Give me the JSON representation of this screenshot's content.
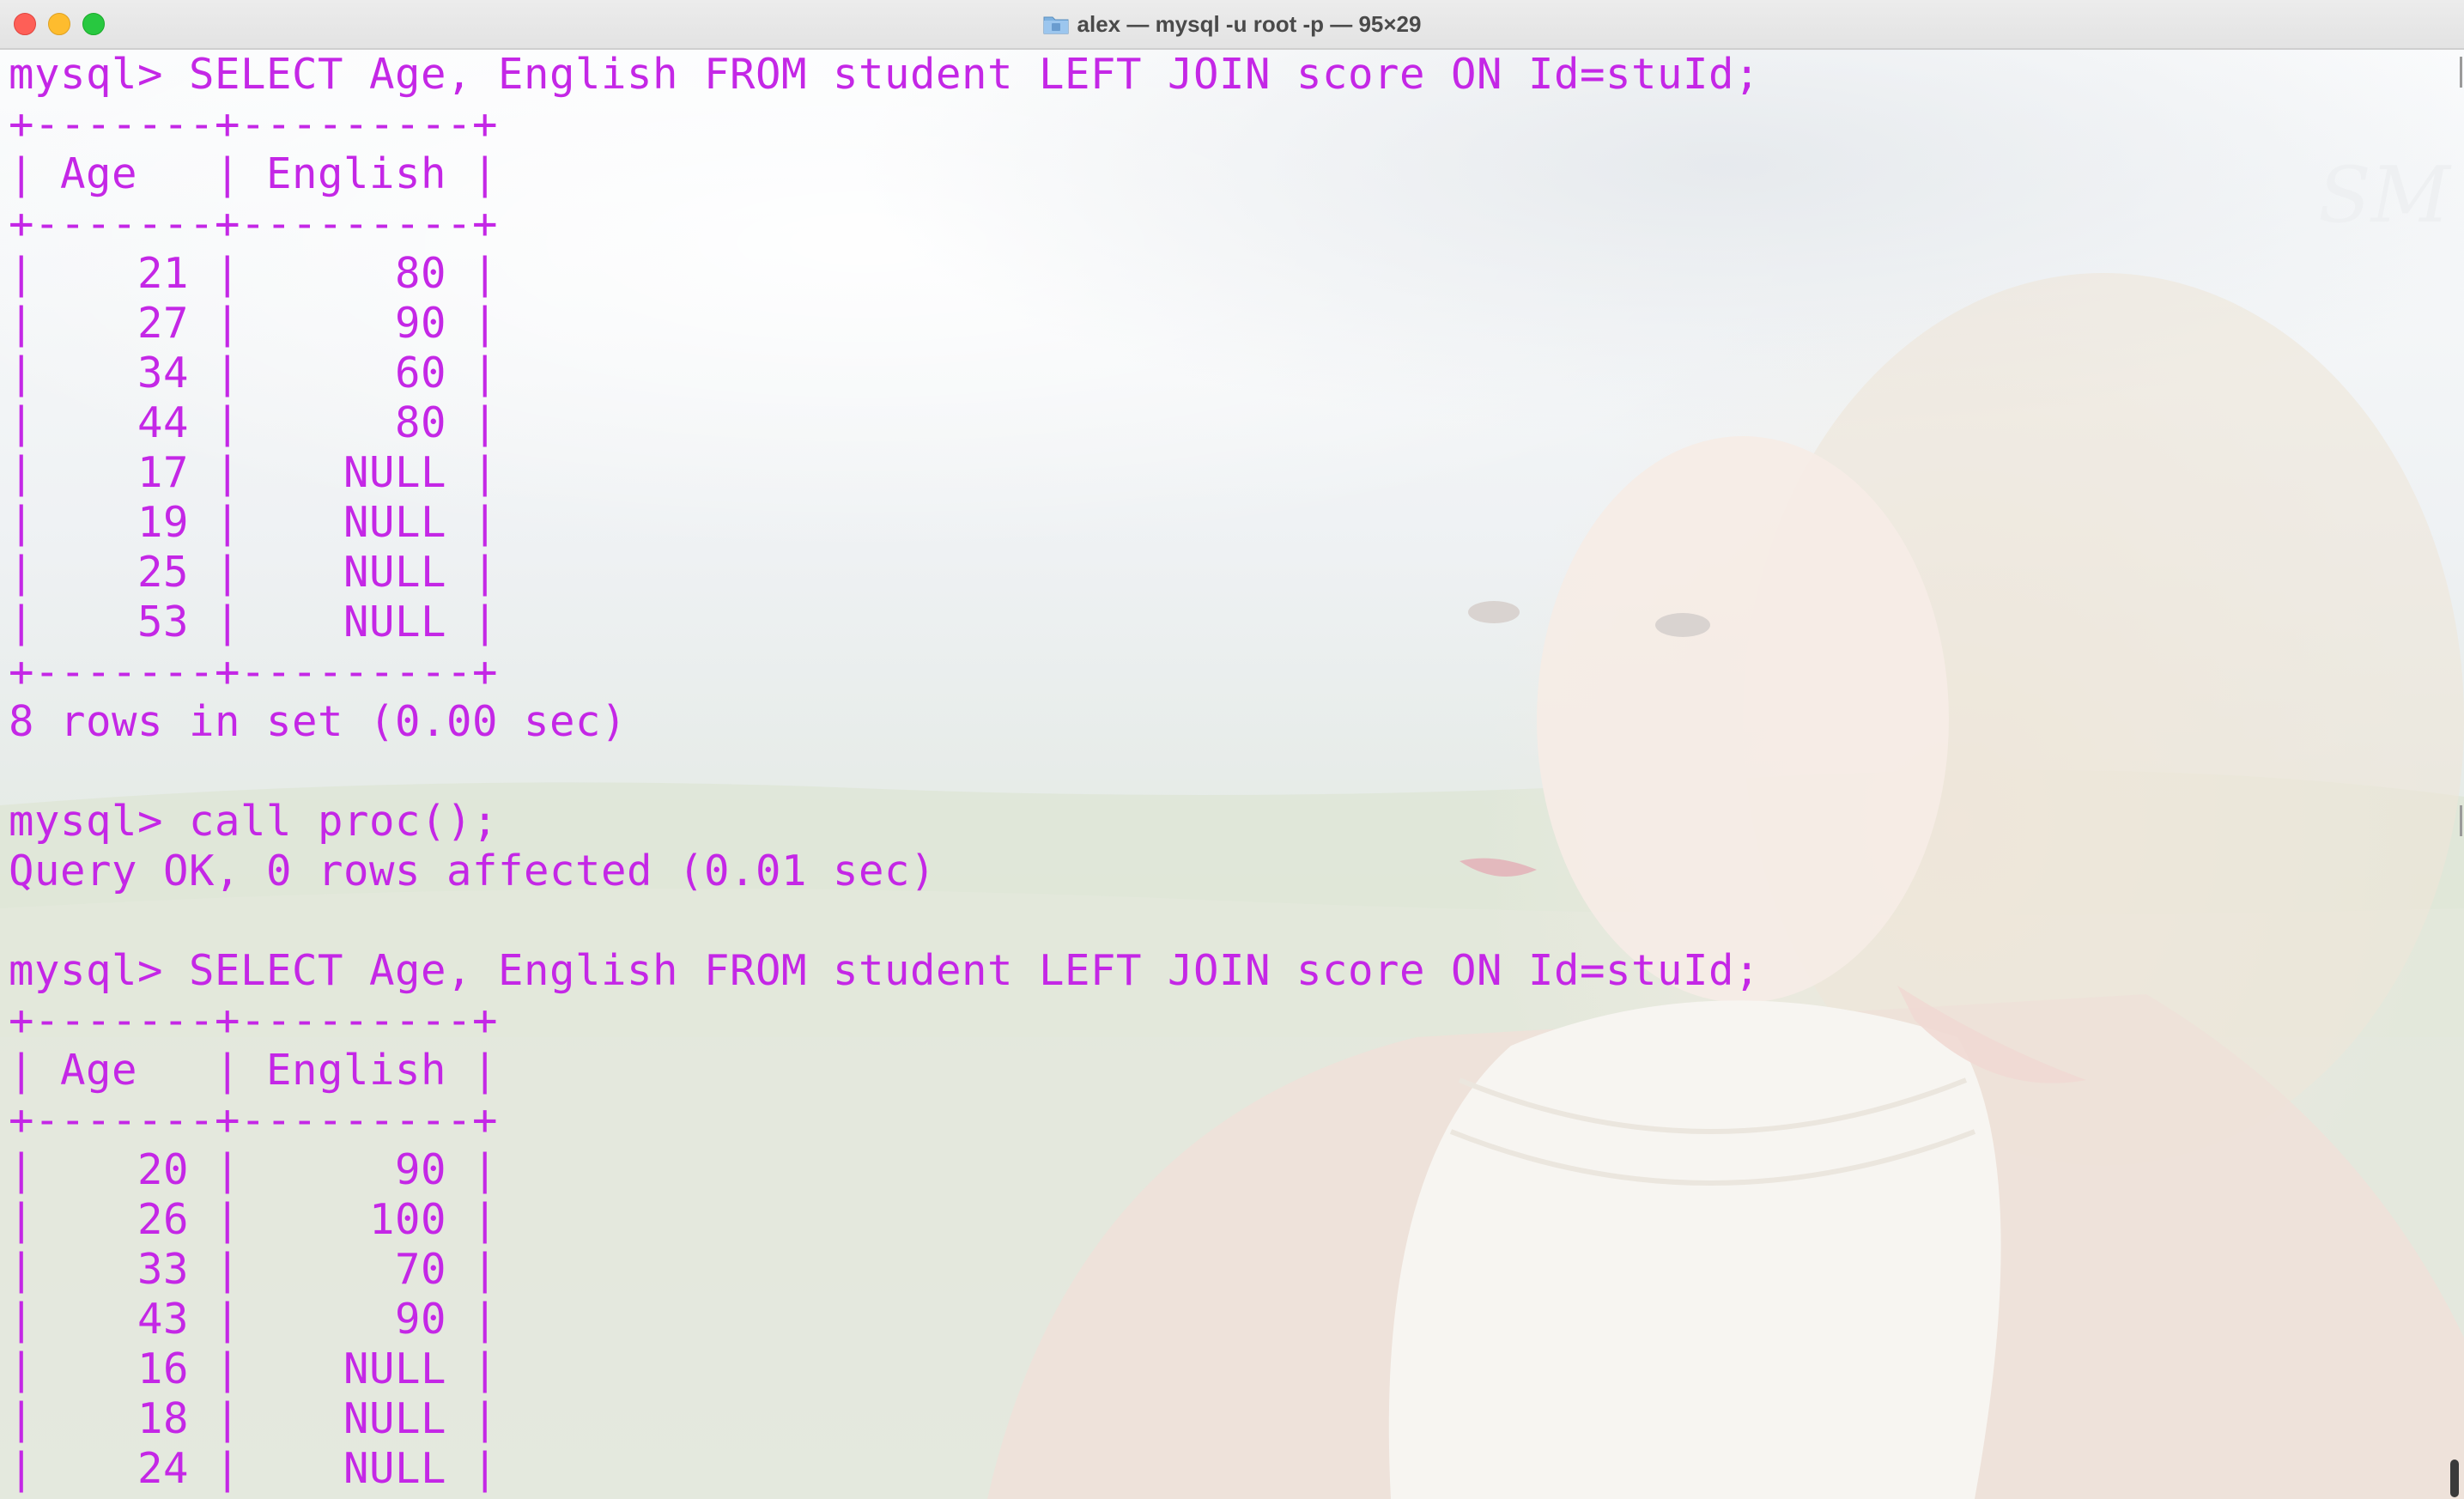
{
  "window": {
    "title": "alex — mysql -u root -p — 95×29"
  },
  "terminal": {
    "lines": [
      "mysql> SELECT Age, English FROM student LEFT JOIN score ON Id=stuId;",
      "+-------+---------+",
      "| Age   | English |",
      "+-------+---------+",
      "|    21 |      80 |",
      "|    27 |      90 |",
      "|    34 |      60 |",
      "|    44 |      80 |",
      "|    17 |    NULL |",
      "|    19 |    NULL |",
      "|    25 |    NULL |",
      "|    53 |    NULL |",
      "+-------+---------+",
      "8 rows in set (0.00 sec)",
      "",
      "mysql> call proc();",
      "Query OK, 0 rows affected (0.01 sec)",
      "",
      "mysql> SELECT Age, English FROM student LEFT JOIN score ON Id=stuId;",
      "+-------+---------+",
      "| Age   | English |",
      "+-------+---------+",
      "|    20 |      90 |",
      "|    26 |     100 |",
      "|    33 |      70 |",
      "|    43 |      90 |",
      "|    16 |    NULL |",
      "|    18 |    NULL |",
      "|    24 |    NULL |"
    ]
  },
  "colors": {
    "text": "#c427e6",
    "titlebar": "#e6e6e6"
  }
}
